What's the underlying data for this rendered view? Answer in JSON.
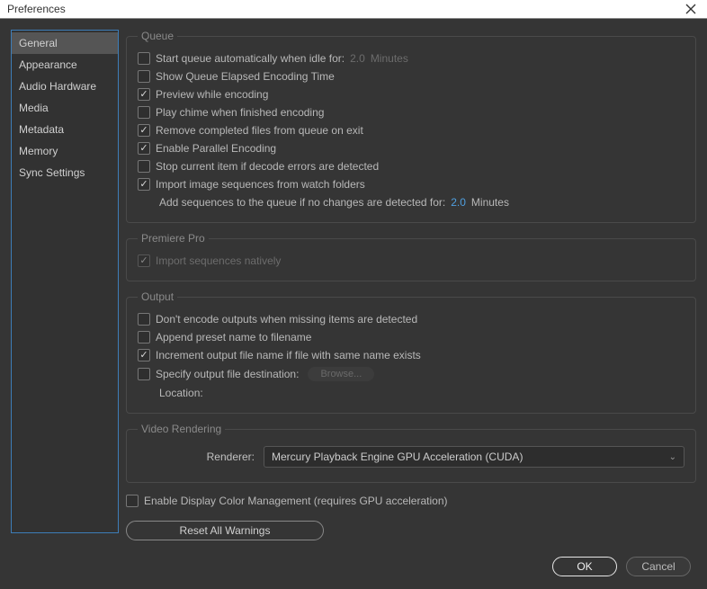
{
  "window": {
    "title": "Preferences"
  },
  "sidebar": {
    "items": [
      {
        "label": "General",
        "selected": true
      },
      {
        "label": "Appearance"
      },
      {
        "label": "Audio Hardware"
      },
      {
        "label": "Media"
      },
      {
        "label": "Metadata"
      },
      {
        "label": "Memory"
      },
      {
        "label": "Sync Settings"
      }
    ]
  },
  "queue": {
    "title": "Queue",
    "start_idle": {
      "label": "Start queue automatically when idle for:",
      "checked": false,
      "value": "2.0",
      "unit": "Minutes"
    },
    "show_elapsed": {
      "label": "Show Queue Elapsed Encoding Time",
      "checked": false
    },
    "preview": {
      "label": "Preview while encoding",
      "checked": true
    },
    "chime": {
      "label": "Play chime when finished encoding",
      "checked": false
    },
    "remove_completed": {
      "label": "Remove completed files from queue on exit",
      "checked": true
    },
    "parallel": {
      "label": "Enable Parallel Encoding",
      "checked": true
    },
    "stop_errors": {
      "label": "Stop current item if decode errors are detected",
      "checked": false
    },
    "import_watch": {
      "label": "Import image sequences from watch folders",
      "checked": true
    },
    "add_seq": {
      "label": "Add sequences to the queue if no changes are detected for:",
      "value": "2.0",
      "unit": "Minutes"
    }
  },
  "premiere": {
    "title": "Premiere Pro",
    "import_native": {
      "label": "Import sequences natively",
      "checked": true,
      "disabled": true
    }
  },
  "output": {
    "title": "Output",
    "dont_encode_missing": {
      "label": "Don't encode outputs when missing items are detected",
      "checked": false
    },
    "append_preset": {
      "label": "Append preset name to filename",
      "checked": false
    },
    "increment": {
      "label": "Increment output file name if file with same name exists",
      "checked": true
    },
    "specify_dest": {
      "label": "Specify output file destination:",
      "checked": false,
      "browse": "Browse..."
    },
    "location_label": "Location:"
  },
  "video_rendering": {
    "title": "Video Rendering",
    "label": "Renderer:",
    "value": "Mercury Playback Engine GPU Acceleration (CUDA)"
  },
  "color_mgmt": {
    "label": "Enable Display Color Management (requires GPU acceleration)",
    "checked": false
  },
  "reset_label": "Reset All Warnings",
  "buttons": {
    "ok": "OK",
    "cancel": "Cancel"
  }
}
